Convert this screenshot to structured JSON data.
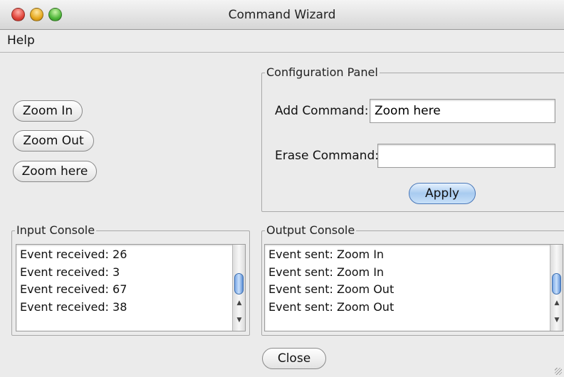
{
  "window": {
    "title": "Command Wizard"
  },
  "menubar": {
    "help": "Help"
  },
  "zoom_buttons": {
    "zoom_in": "Zoom In",
    "zoom_out": "Zoom Out",
    "zoom_here": "Zoom here"
  },
  "config_panel": {
    "title": "Configuration Panel",
    "add_label": "Add Command:",
    "add_value": "Zoom here",
    "erase_label": "Erase Command:",
    "erase_value": "",
    "apply_label": "Apply"
  },
  "input_console": {
    "title": "Input Console",
    "lines": [
      "Event received: 26",
      "Event received: 3",
      "Event received: 67",
      "Event received: 38"
    ]
  },
  "output_console": {
    "title": "Output Console",
    "lines": [
      "Event sent: Zoom In",
      "Event sent: Zoom In",
      "Event sent: Zoom Out",
      "Event sent: Zoom Out"
    ]
  },
  "close_label": "Close",
  "icons": {
    "close": "red-traffic-light",
    "minimize": "yellow-traffic-light",
    "zoom": "green-traffic-light",
    "scroll_up": "scroll-up-arrow",
    "scroll_down": "scroll-down-arrow"
  },
  "colors": {
    "accent": "#a8cbf0",
    "close": "#e0443a",
    "minimize": "#e6a91f",
    "zoom": "#4fb63a"
  }
}
